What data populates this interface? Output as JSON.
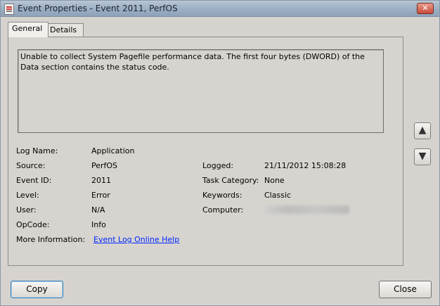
{
  "window": {
    "title": "Event Properties - Event 2011, PerfOS",
    "close_glyph": "✕"
  },
  "tabs": [
    {
      "label": "General",
      "active": true
    },
    {
      "label": "Details",
      "active": false
    }
  ],
  "message": "Unable to collect System Pagefile performance data. The first four bytes (DWORD) of the Data section contains the status code.",
  "fields": {
    "log_name": {
      "label": "Log Name:",
      "value": "Application"
    },
    "source": {
      "label": "Source:",
      "value": "PerfOS"
    },
    "event_id": {
      "label": "Event ID:",
      "value": "2011"
    },
    "level": {
      "label": "Level:",
      "value": "Error"
    },
    "user": {
      "label": "User:",
      "value": "N/A"
    },
    "opcode": {
      "label": "OpCode:",
      "value": "Info"
    },
    "more_information": {
      "label": "More Information:",
      "link": "Event Log Online Help"
    },
    "logged": {
      "label": "Logged:",
      "value": "21/11/2012 15:08:28"
    },
    "task_category": {
      "label": "Task Category:",
      "value": "None"
    },
    "keywords": {
      "label": "Keywords:",
      "value": "Classic"
    },
    "computer": {
      "label": "Computer:",
      "value": ""
    }
  },
  "nav": {
    "up_icon": "up-arrow-icon",
    "down_icon": "down-arrow-icon"
  },
  "buttons": {
    "copy": "Copy",
    "close": "Close"
  }
}
